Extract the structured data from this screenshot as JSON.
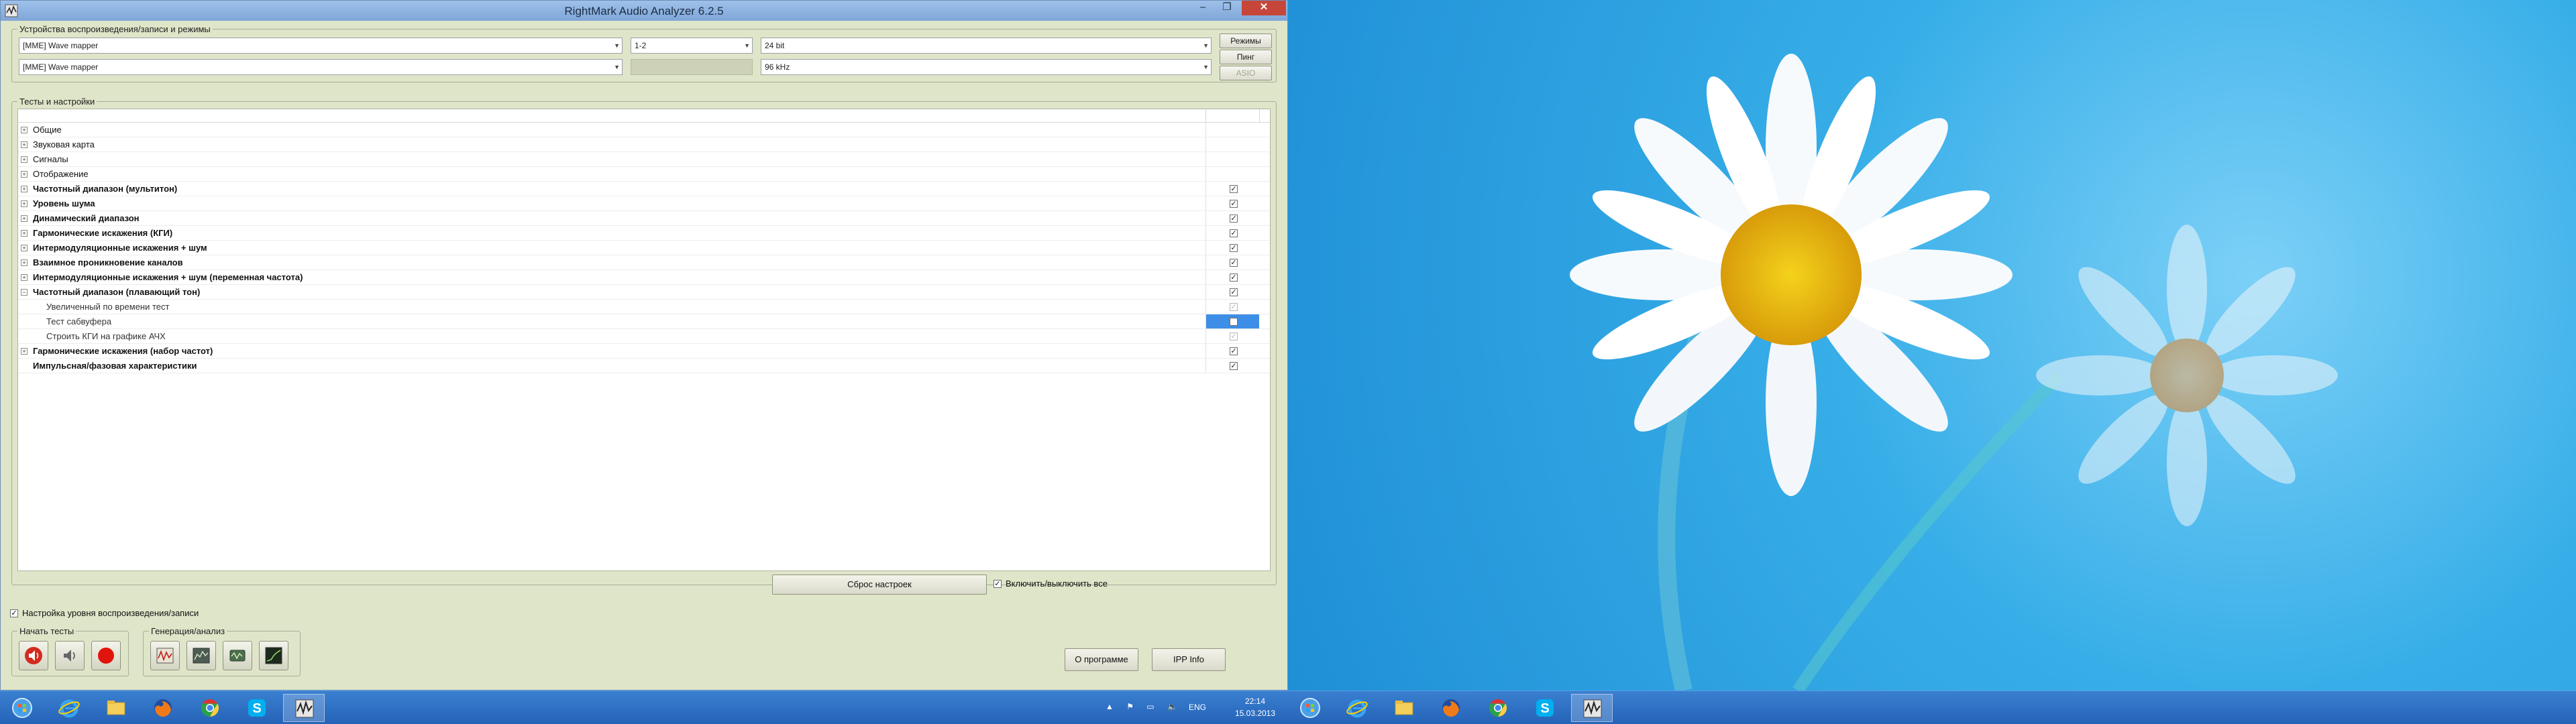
{
  "window": {
    "title": "RightMark Audio Analyzer 6.2.5",
    "minimize": "–",
    "maximize": "❐",
    "close": "✕"
  },
  "devices": {
    "group_title": "Устройства воспроизведения/записи и режимы",
    "playback_device": "[MME] Wave mapper",
    "recording_device": "[MME] Wave mapper",
    "channels": "1-2",
    "channels_rec": "",
    "bit_depth": "24 bit",
    "sample_rate": "96 kHz",
    "buttons": {
      "modes": "Режимы",
      "ping": "Пинг",
      "asio": "ASIO"
    }
  },
  "tests": {
    "group_title": "Тесты и настройки",
    "rows": [
      {
        "label": "Общие",
        "bold": false,
        "child": false,
        "expander": "+",
        "check": null
      },
      {
        "label": "Звуковая карта",
        "bold": false,
        "child": false,
        "expander": "+",
        "check": null
      },
      {
        "label": "Сигналы",
        "bold": false,
        "child": false,
        "expander": "+",
        "check": null
      },
      {
        "label": "Отображение",
        "bold": false,
        "child": false,
        "expander": "+",
        "check": null
      },
      {
        "label": "Частотный диапазон (мультитон)",
        "bold": true,
        "child": false,
        "expander": "+",
        "check": "on"
      },
      {
        "label": "Уровень шума",
        "bold": true,
        "child": false,
        "expander": "+",
        "check": "on"
      },
      {
        "label": "Динамический диапазон",
        "bold": true,
        "child": false,
        "expander": "+",
        "check": "on"
      },
      {
        "label": "Гармонические искажения (КГИ)",
        "bold": true,
        "child": false,
        "expander": "+",
        "check": "on"
      },
      {
        "label": "Интермодуляционные искажения + шум",
        "bold": true,
        "child": false,
        "expander": "+",
        "check": "on"
      },
      {
        "label": "Взаимное проникновение каналов",
        "bold": true,
        "child": false,
        "expander": "+",
        "check": "on"
      },
      {
        "label": "Интермодуляционные искажения + шум (переменная частота)",
        "bold": true,
        "child": false,
        "expander": "+",
        "check": "on"
      },
      {
        "label": "Частотный диапазон (плавающий тон)",
        "bold": true,
        "child": false,
        "expander": "−",
        "check": "on"
      },
      {
        "label": "Увеличенный по времени тест",
        "bold": false,
        "child": true,
        "expander": "",
        "check": "dim"
      },
      {
        "label": "Тест сабвуфера",
        "bold": false,
        "child": true,
        "expander": "",
        "check": "selected"
      },
      {
        "label": "Строить КГИ на графике АЧХ",
        "bold": false,
        "child": true,
        "expander": "",
        "check": "dim"
      },
      {
        "label": "Гармонические искажения (набор частот)",
        "bold": true,
        "child": false,
        "expander": "+",
        "check": "on"
      },
      {
        "label": "Импульсная/фазовая характеристики",
        "bold": true,
        "child": false,
        "expander": "",
        "check": "on"
      }
    ]
  },
  "controls": {
    "reset": "Сброс настроек",
    "toggle_all": "Включить/выключить все",
    "level_setting": "Настройка уровня воспроизведения/записи",
    "start_group": "Начать тесты",
    "gen_group": "Генерация/анализ",
    "about": "О программе",
    "ipp": "IPP Info"
  },
  "taskbar": {
    "language": "ENG",
    "time": "22:14",
    "date": "15.03.2013",
    "tray_icons": "▲ ⚑ ▭ 🔈"
  },
  "colors": {
    "window_bg": "#dfe5c8",
    "titlebar": "#8db3e2",
    "selection": "#3d8ee6",
    "taskbar": "#2f6fc4",
    "wallpaper": "#2fa4e6"
  }
}
